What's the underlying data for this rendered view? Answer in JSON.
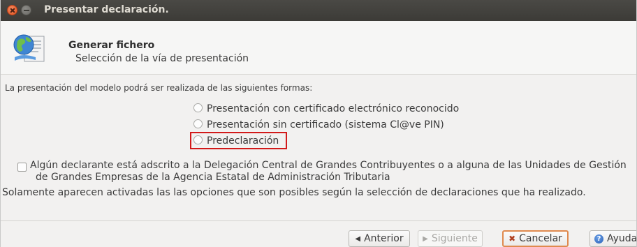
{
  "window": {
    "title": "Presentar declaración."
  },
  "header": {
    "title": "Generar fichero",
    "subtitle": "Selección de la vía de presentación",
    "icon": "globe-document-icon"
  },
  "intro_text": "La presentación del modelo podrá ser realizada de las siguientes formas:",
  "options": [
    {
      "label": "Presentación con certificado electrónico reconocido",
      "selected": false
    },
    {
      "label": "Presentación sin certificado (sistema Cl@ve PIN)",
      "selected": false
    },
    {
      "label": "Predeclaración",
      "selected": false,
      "highlighted": true
    }
  ],
  "checkbox": {
    "line1": "Algún declarante está adscrito a la Delegación Central de Grandes Contribuyentes o a alguna de las Unidades de Gestión",
    "line2": "de Grandes Empresas de la Agencia Estatal de Administración Tributaria",
    "checked": false
  },
  "note": "Solamente aparecen activadas las las opciones que son posibles según la selección de declaraciones que ha realizado.",
  "buttons": {
    "prev": "Anterior",
    "next": "Siguiente",
    "cancel": "Cancelar",
    "help": "Ayuda"
  },
  "colors": {
    "highlight": "#d21a1a",
    "titlebar": "#3c3b37",
    "cancel_border": "#e08a4e"
  }
}
